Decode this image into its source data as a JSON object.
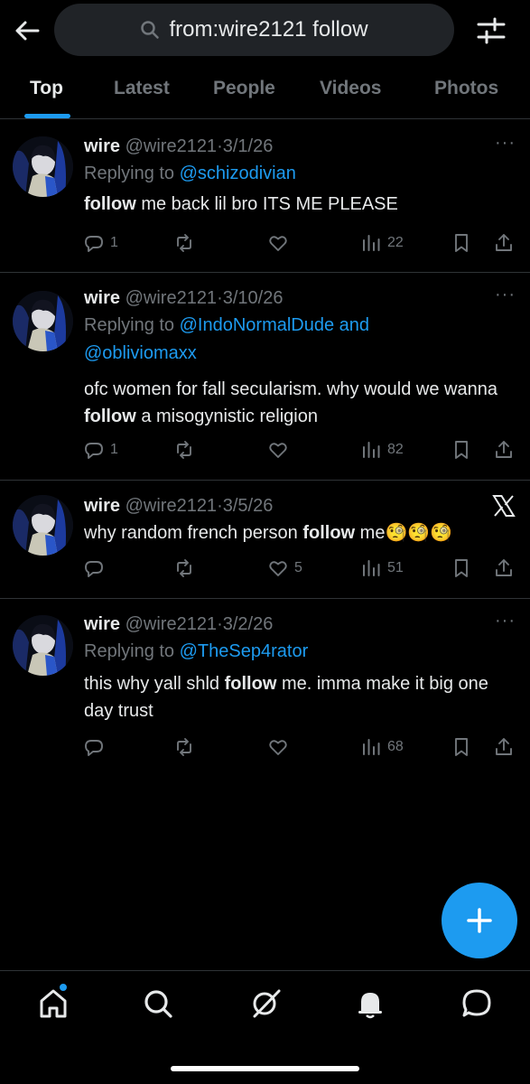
{
  "search": {
    "query": "from:wire2121 follow"
  },
  "tabs": [
    {
      "label": "Top",
      "active": true
    },
    {
      "label": "Latest"
    },
    {
      "label": "People"
    },
    {
      "label": "Videos"
    },
    {
      "label": "Photos"
    }
  ],
  "posts": [
    {
      "name": "wire",
      "handle": "@wire2121",
      "date": "3/1/26",
      "replying_prefix": "Replying to ",
      "replying_to": "@schizodivian",
      "text_bold": "follow",
      "text_after": " me back lil bro ITS ME PLEASE",
      "replies": "1",
      "reposts": "",
      "likes": "",
      "views": "22"
    },
    {
      "name": "wire",
      "handle": "@wire2121",
      "date": "3/10/26",
      "replying_prefix": "Replying to ",
      "replying_to": "@IndoNormalDude and",
      "replying_to_2": "@obliviomaxx",
      "text_before": "ofc women for fall secularism. why would we wanna ",
      "text_bold": "follow",
      "text_after": " a misogynistic religion",
      "replies": "1",
      "reposts": "",
      "likes": "",
      "views": "82"
    },
    {
      "name": "wire",
      "handle": "@wire2121",
      "date": "3/5/26",
      "text_before": "why random french person ",
      "text_bold": "follow",
      "text_after": " me🧐🧐🧐",
      "replies": "",
      "reposts": "",
      "likes": "5",
      "views": "51"
    },
    {
      "name": "wire",
      "handle": "@wire2121",
      "date": "3/2/26",
      "replying_prefix": "Replying to ",
      "replying_to": "@TheSep4rator",
      "text_before": "this why yall shld ",
      "text_bold": "follow",
      "text_after": " me. imma make it big one day trust",
      "replies": "",
      "reposts": "",
      "likes": "",
      "views": "68"
    }
  ],
  "separator": "·",
  "more_glyph": "···",
  "colors": {
    "accent": "#1d9bf0",
    "muted": "#71767b",
    "text": "#e7e9ea",
    "divider": "#2f3336"
  },
  "icons": [
    "back-arrow-icon",
    "search-icon",
    "filter-sliders-icon",
    "reply-icon",
    "repost-icon",
    "like-icon",
    "views-icon",
    "bookmark-icon",
    "share-icon",
    "x-logo-icon",
    "plus-icon",
    "home-icon",
    "explore-icon",
    "grok-icon",
    "notifications-icon",
    "messages-icon"
  ]
}
